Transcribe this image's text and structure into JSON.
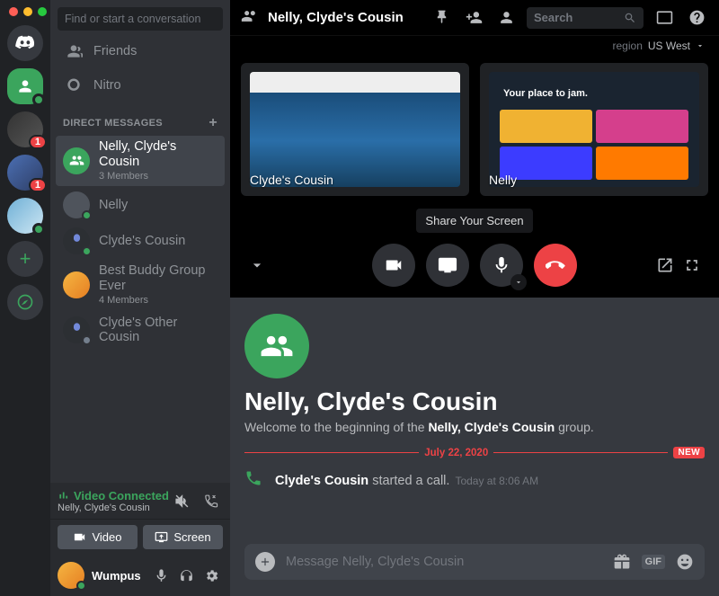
{
  "search_placeholder": "Find or start a conversation",
  "nav": {
    "friends": "Friends",
    "nitro": "Nitro"
  },
  "dm_header": "DIRECT MESSAGES",
  "dms": [
    {
      "name": "Nelly, Clyde's Cousin",
      "sub": "3 Members"
    },
    {
      "name": "Nelly"
    },
    {
      "name": "Clyde's Cousin"
    },
    {
      "name": "Best Buddy Group Ever",
      "sub": "4 Members"
    },
    {
      "name": "Clyde's Other Cousin"
    }
  ],
  "voice": {
    "status": "Video Connected",
    "channel": "Nelly, Clyde's Cousin"
  },
  "vbuttons": {
    "video": "Video",
    "screen": "Screen"
  },
  "user": {
    "name": "Wumpus"
  },
  "topbar": {
    "title": "Nelly, Clyde's Cousin",
    "search": "Search"
  },
  "region": {
    "label": "region",
    "value": "US West"
  },
  "streams": [
    {
      "tag": "Clyde's Cousin"
    },
    {
      "tag": "Nelly",
      "jam": "Your place to jam."
    }
  ],
  "tooltip": "Share Your Screen",
  "chat": {
    "title": "Nelly, Clyde's Cousin",
    "welcome_pre": "Welcome to the beginning of the ",
    "welcome_bold": "Nelly, Clyde's Cousin",
    "welcome_post": " group.",
    "divider_date": "July 22, 2020",
    "divider_new": "NEW",
    "call_user": "Clyde's Cousin",
    "call_action": " started a call.",
    "call_time": "Today at 8:06 AM",
    "composer": "Message Nelly, Clyde's Cousin",
    "gif": "GIF"
  },
  "servers": {
    "badge1": "1",
    "badge2": "1"
  }
}
